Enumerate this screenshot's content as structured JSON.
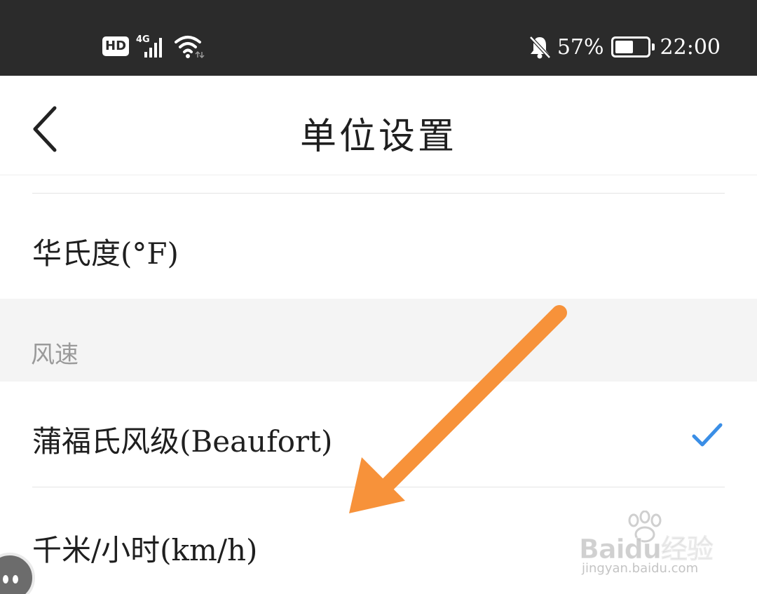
{
  "status_bar": {
    "hd_label": "HD",
    "network_label": "4G",
    "battery_percent_text": "57%",
    "battery_level": 0.57,
    "time": "22:00",
    "icons": [
      "signal-bars-icon",
      "wifi-icon",
      "bell-off-icon",
      "battery-icon"
    ]
  },
  "header": {
    "title": "单位设置",
    "back_icon": "chevron-left-icon"
  },
  "sections": {
    "temperature": {
      "options": [
        {
          "label": "华氏度(°F)",
          "selected": false
        }
      ]
    },
    "wind_speed": {
      "title": "风速",
      "options": [
        {
          "label": "蒲福氏风级(Beaufort)",
          "selected": true
        },
        {
          "label": "千米/小时(km/h)",
          "selected": false
        }
      ]
    }
  },
  "watermark": {
    "brand": "Baidu经验",
    "url": "jingyan.baidu.com"
  },
  "colors": {
    "status_bar_bg": "#2b2b2b",
    "check_accent": "#3a8ee6",
    "annotation_arrow": "#f7923a",
    "section_bg": "#f4f4f4"
  }
}
